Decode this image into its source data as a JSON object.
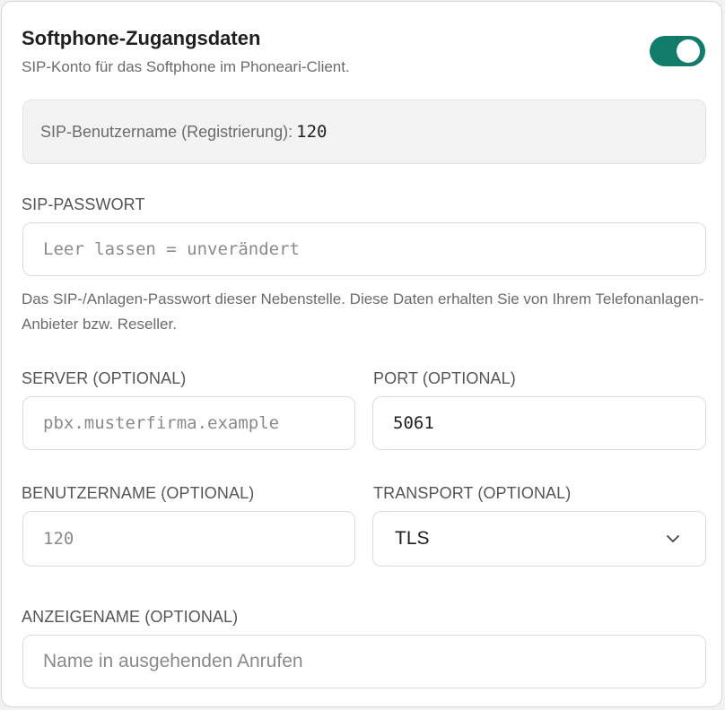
{
  "header": {
    "title": "Softphone-Zugangsdaten",
    "subtitle": "SIP-Konto für das Softphone im Phoneari-Client.",
    "toggle_enabled": true
  },
  "registration": {
    "label": "SIP-Benutzername (Registrierung):",
    "value": "120"
  },
  "password": {
    "label": "SIP-PASSWORT",
    "placeholder": "Leer lassen = unverändert",
    "help": "Das SIP-/Anlagen-Passwort dieser Nebenstelle. Diese Daten erhalten Sie von Ihrem Telefonanlagen-Anbieter bzw. Reseller."
  },
  "server": {
    "label": "SERVER (OPTIONAL)",
    "placeholder": "pbx.musterfirma.example"
  },
  "port": {
    "label": "PORT (OPTIONAL)",
    "value": "5061"
  },
  "username": {
    "label": "BENUTZERNAME (OPTIONAL)",
    "placeholder": "120"
  },
  "transport": {
    "label": "TRANSPORT (OPTIONAL)",
    "selected": "TLS"
  },
  "display_name": {
    "label": "ANZEIGENAME (OPTIONAL)",
    "placeholder": "Name in ausgehenden Anrufen"
  },
  "colors": {
    "accent": "#137b6a",
    "muted_text": "#6b6b6b",
    "border": "#dcdcdc"
  },
  "icons": {
    "transport_dropdown": "chevron-down-icon"
  }
}
